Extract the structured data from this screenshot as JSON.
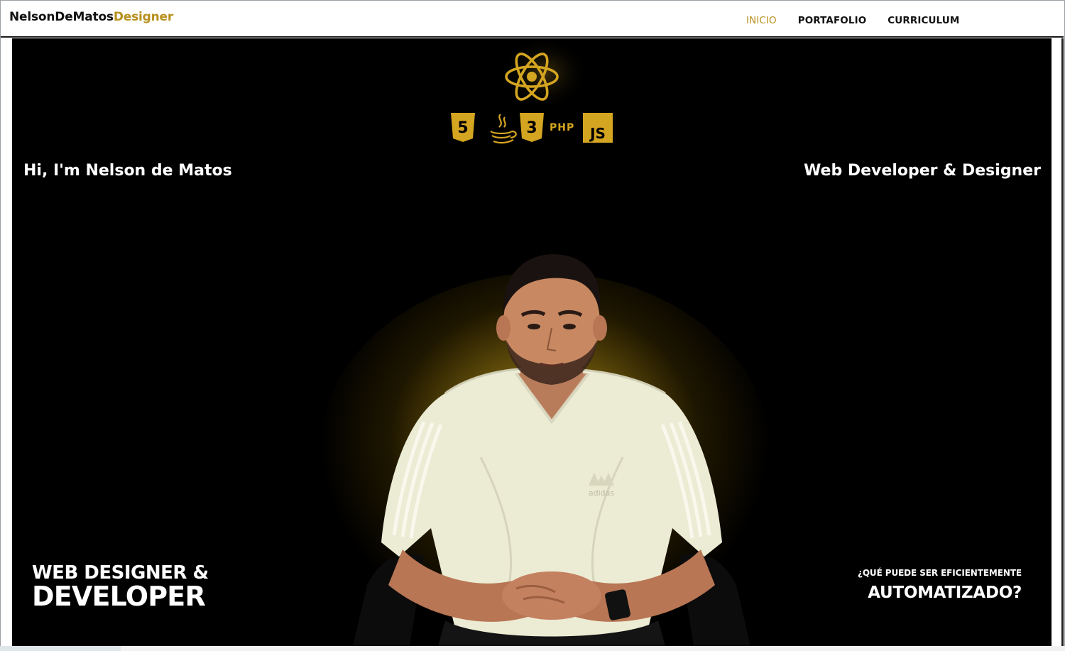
{
  "navbar": {
    "brand_part1": "NelsonDeMatos",
    "brand_part2": "Designer",
    "links": [
      {
        "label": "INICIO",
        "active": true
      },
      {
        "label": "PORTAFOLIO",
        "active": false
      },
      {
        "label": "CURRICULUM",
        "active": false
      }
    ]
  },
  "hero": {
    "greeting": "Hi, I'm Nelson de Matos",
    "role": "Web Developer & Designer",
    "tech_icons": [
      "html5-icon",
      "java-icon",
      "css3-icon",
      "php-icon",
      "js-icon"
    ],
    "php_label": "PHP",
    "js_label": "JS",
    "html_digit": "5",
    "css_digit": "3",
    "badge_line1": "WEB DESIGNER &",
    "badge_line2": "DEVELOPER",
    "question_line1": "¿QUÉ PUEDE SER EFICIENTEMENTE",
    "question_line2": "AUTOMATIZADO?",
    "shirt_brand": "adidas"
  },
  "colors": {
    "accent": "#b8901e",
    "gold_icon": "#d4a520",
    "background": "#000000",
    "nav_text": "#111111"
  }
}
